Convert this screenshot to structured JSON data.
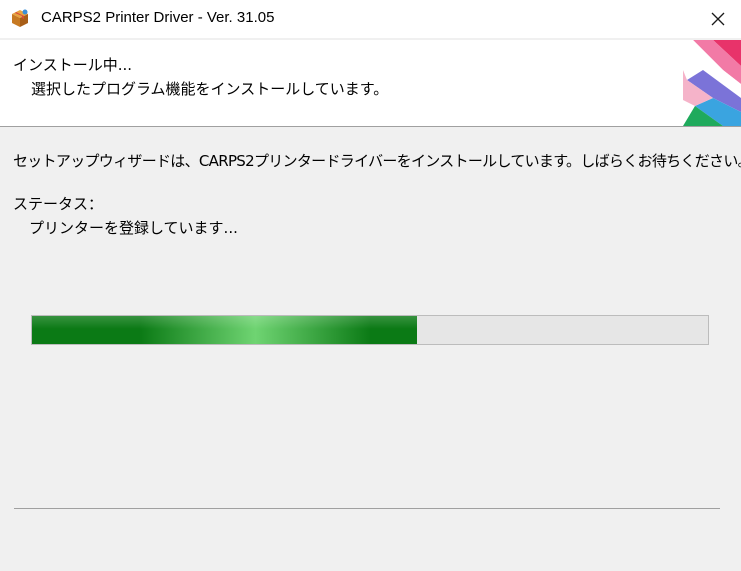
{
  "window": {
    "title": "CARPS2 Printer Driver - Ver. 31.05",
    "app_icon": "installer-box-icon",
    "close_icon": "close-icon"
  },
  "header": {
    "title": "インストール中...",
    "subtitle": "選択したプログラム機能をインストールしています。",
    "banner": "colorful-ribbon-graphic"
  },
  "body": {
    "message": "セットアップウィザードは、CARPS2プリンタードライバーをインストールしています。しばらくお待ちください。",
    "status_label": "ステータス：",
    "status_text": "プリンターを登録しています..."
  },
  "progress": {
    "value": 0.57,
    "fill_color": "#0b7a15",
    "highlight_color": "#6fd472"
  }
}
